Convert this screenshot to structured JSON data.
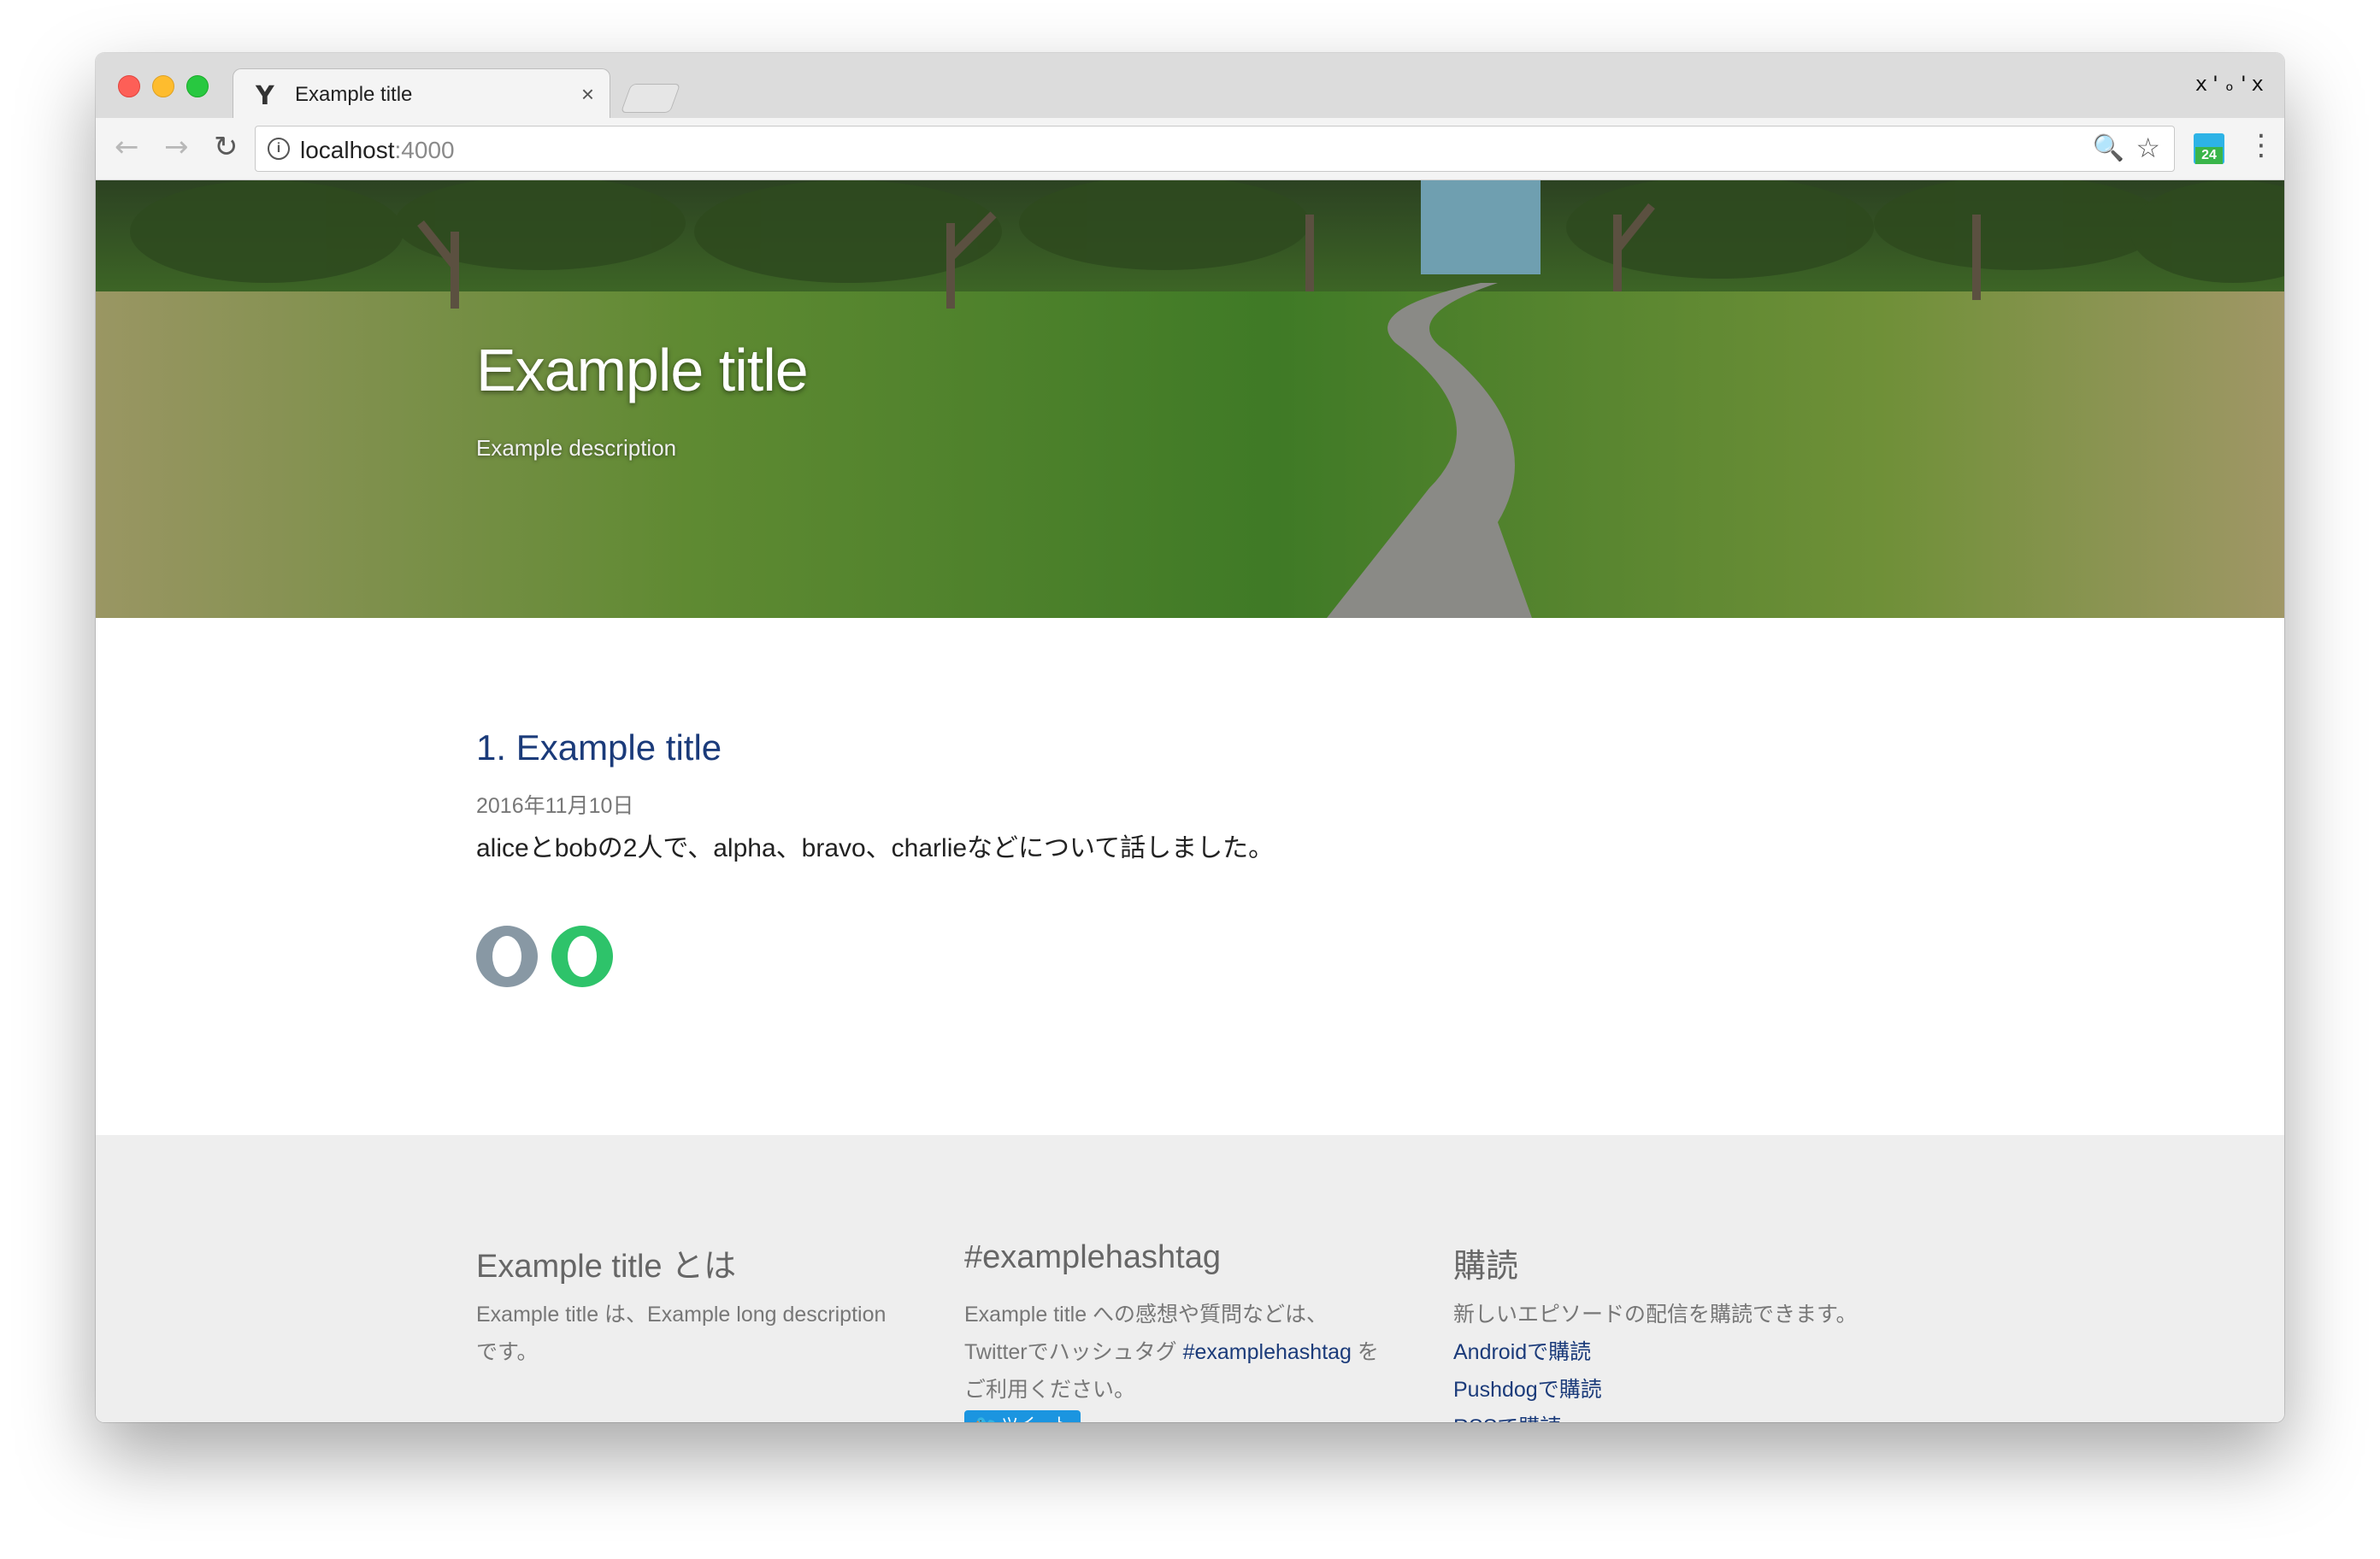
{
  "browser": {
    "tab_title": "Example title",
    "tab_favicon": "Y",
    "tab_close": "×",
    "window_controls": "x'ₒ'x",
    "url_host": "localhost",
    "url_port": ":4000",
    "extension_badge": "24"
  },
  "icons": {
    "back": "←",
    "forward": "→",
    "reload": "↻",
    "info": "i",
    "zoom": "🔍",
    "star": "☆",
    "menu": "⋮"
  },
  "hero": {
    "title": "Example title",
    "description": "Example description"
  },
  "episode": {
    "title": "1. Example title",
    "date": "2016年11月10日",
    "summary": "aliceとbobの2人で、alpha、bravo、charlieなどについて話しました。",
    "participants": [
      {
        "name": "alice",
        "color": "#8898a4"
      },
      {
        "name": "bob",
        "color": "#2ec36a"
      }
    ]
  },
  "footer": {
    "about": {
      "heading": "Example title とは",
      "line1": "Example title は、Example long description",
      "line2": "です。"
    },
    "hashtag": {
      "heading": "#examplehashtag",
      "line1": "Example title への感想や質問などは、",
      "line2_prefix": "Twitterでハッシュタグ ",
      "line2_link": "#examplehashtag",
      "line2_suffix": " を",
      "line3": "ご利用ください。",
      "tweet_button": "ツイート"
    },
    "subscribe": {
      "heading": "購読",
      "description": "新しいエピソードの配信を購読できます。",
      "links": [
        "Androidで購読",
        "Pushdogで購読",
        "RSSで購読"
      ]
    }
  },
  "colors": {
    "link": "#1b3b7a",
    "tweet": "#1b95e0",
    "footer_bg": "#eeeeee"
  }
}
